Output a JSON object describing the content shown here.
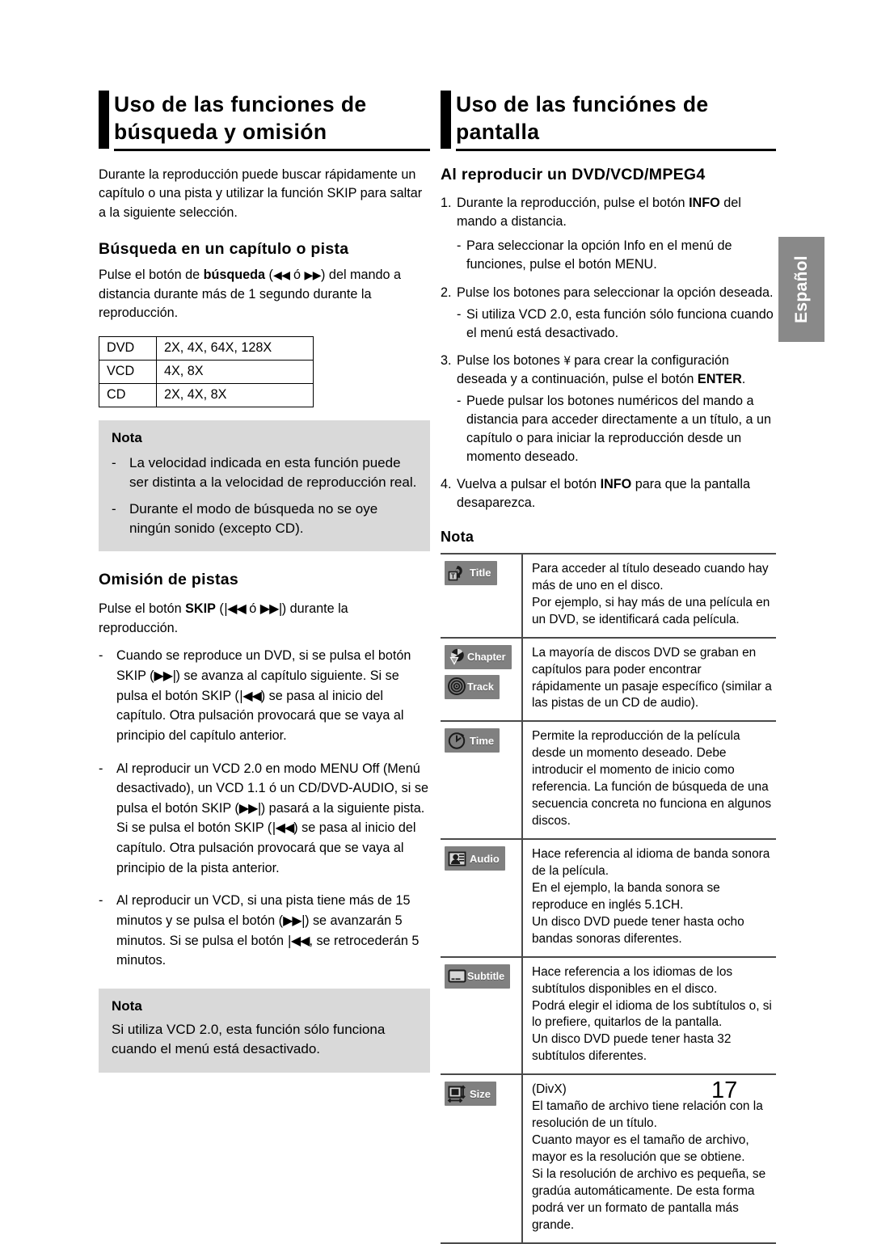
{
  "page": {
    "number": "17",
    "language_tab": "Español"
  },
  "left": {
    "heading": "Uso de las funciones de búsqueda y omisión",
    "intro": "Durante la reproducción puede buscar rápidamente un capítulo o una pista y utilizar la función SKIP para saltar a la siguiente selección.",
    "sub1": {
      "title": "Búsqueda en un capítulo o pista",
      "p_a": "Pulse el botón de ",
      "p_b": "búsqueda",
      "p_c": " (",
      "p_rew": "◀◀",
      "p_o": " ó ",
      "p_ff": "▶▶",
      "p_d": ") del mando a distancia durante más de 1 segundo durante la reproducción."
    },
    "speed_table": {
      "rows": [
        {
          "format": "DVD",
          "speeds": "2X, 4X, 64X, 128X"
        },
        {
          "format": "VCD",
          "speeds": "4X, 8X"
        },
        {
          "format": "CD",
          "speeds": "2X, 4X, 8X"
        }
      ]
    },
    "nota1": {
      "title": "Nota",
      "dash": "-",
      "items": [
        "La velocidad indicada en esta función puede ser distinta a la velocidad de reproducción real.",
        "Durante el modo de búsqueda no se oye ningún sonido (excepto CD)."
      ]
    },
    "sub2": {
      "title": "Omisión de pistas",
      "lead_a": "Pulse el botón ",
      "lead_b": "SKIP",
      "lead_c": " (",
      "lead_prev": "|◀◀",
      "lead_o": " ó ",
      "lead_next": "▶▶|",
      "lead_d": ") durante la reproducción.",
      "dash": "-",
      "item1_a": "Cuando se reproduce un DVD, si se pulsa el botón SKIP (",
      "item1_next": "▶▶|",
      "item1_b": ") se avanza al capítulo siguiente. Si se pulsa el botón SKIP (",
      "item1_prev": "|◀◀",
      "item1_c": ") se pasa al inicio del capítulo. Otra pulsación provocará que se vaya al principio del capítulo anterior.",
      "item2_a": "Al reproducir un VCD 2.0 en modo MENU Off (Menú desactivado), un VCD 1.1 ó un CD/DVD-AUDIO, si se pulsa el botón SKIP (",
      "item2_next": "▶▶|",
      "item2_b": ") pasará a la siguiente pista. Si se pulsa el botón SKIP (",
      "item2_prev": "|◀◀",
      "item2_c": ") se pasa al inicio del capítulo. Otra pulsación provocará que se vaya al principio de la pista anterior.",
      "item3_a": "Al reproducir un VCD, si una pista tiene más de 15 minutos y se pulsa el botón (",
      "item3_next": "▶▶|",
      "item3_b": ") se avanzarán 5 minutos. Si se pulsa el botón ",
      "item3_prev": "|◀◀",
      "item3_c": ", se retrocederán 5 minutos."
    },
    "nota2": {
      "title": "Nota",
      "text": "Si utiliza VCD 2.0, esta función sólo funciona cuando el menú está desactivado."
    }
  },
  "right": {
    "heading": "Uso de las funciónes de pantalla",
    "sub1_title": "Al reproducir un DVD/VCD/MPEG4",
    "steps": [
      {
        "num": "1.",
        "text_a": "Durante la reproducción, pulse el botón ",
        "bold": "INFO",
        "text_b": " del mando a distancia.",
        "sub": [
          {
            "dash": "-",
            "text": "Para seleccionar la opción Info en el menú de funciones, pulse el botón MENU."
          }
        ]
      },
      {
        "num": "2.",
        "text_a": "Pulse los botones ",
        "glyph": "        ",
        "text_b": "para seleccionar la opción deseada.",
        "sub": [
          {
            "dash": "-",
            "text": "Si utiliza VCD 2.0, esta función sólo funciona cuando el menú está desactivado."
          }
        ]
      },
      {
        "num": "3.",
        "text_a": "Pulse los botones ",
        "glyph": "¥",
        "text_b": "    para crear la configuración deseada y a continuación, pulse el botón ",
        "bold": "ENTER",
        "text_c": ".",
        "sub": [
          {
            "dash": "-",
            "text": "Puede pulsar los botones numéricos del mando a distancia para acceder directamente a un título, a un capítulo o para iniciar la reproducción desde un momento deseado."
          }
        ]
      },
      {
        "num": "4.",
        "text_a": "Vuelva a pulsar el botón ",
        "bold": "INFO",
        "text_b": " para que la pantalla desaparezca.",
        "sub": []
      }
    ],
    "nota_title": "Nota",
    "legend": [
      {
        "icons": [
          {
            "name": "title-icon",
            "label": "Title"
          }
        ],
        "lines": [
          "Para acceder al título deseado cuando hay más de uno en el disco.",
          "Por ejemplo, si hay más de una película en un DVD, se identificará cada película."
        ]
      },
      {
        "icons": [
          {
            "name": "chapter-icon",
            "label": "Chapter"
          },
          {
            "name": "track-icon",
            "label": "Track"
          }
        ],
        "lines": [
          "La mayoría de discos DVD se graban en capítulos para poder encontrar rápidamente un pasaje específico (similar a las pistas de un CD de audio)."
        ]
      },
      {
        "icons": [
          {
            "name": "time-icon",
            "label": "Time"
          }
        ],
        "lines": [
          "Permite la reproducción de la película desde un momento deseado. Debe introducir el momento de inicio como referencia. La función de búsqueda de una secuencia concreta no funciona en algunos discos."
        ]
      },
      {
        "icons": [
          {
            "name": "audio-icon",
            "label": "Audio"
          }
        ],
        "lines": [
          "Hace referencia al idioma de banda sonora de la película.",
          "En el ejemplo, la banda sonora se reproduce en inglés 5.1CH.",
          "Un disco DVD puede tener hasta ocho bandas sonoras diferentes."
        ]
      },
      {
        "icons": [
          {
            "name": "subtitle-icon",
            "label": "Subtitle"
          }
        ],
        "lines": [
          "Hace referencia a los idiomas de los subtítulos disponibles en el disco.",
          "Podrá elegir el idioma de los subtítulos o, si lo prefiere, quitarlos de la pantalla.",
          "Un disco DVD puede tener hasta 32 subtítulos diferentes."
        ]
      },
      {
        "icons": [
          {
            "name": "size-icon",
            "label": "Size"
          }
        ],
        "lines": [
          "(DivX)",
          "El tamaño de archivo tiene relación con la resolución de un título.",
          "Cuanto mayor es el tamaño de archivo, mayor es la resolución que se obtiene.",
          "Si la resolución de archivo es pequeña, se gradúa automáticamente. De esta forma podrá ver un formato de pantalla más grande."
        ]
      }
    ]
  }
}
